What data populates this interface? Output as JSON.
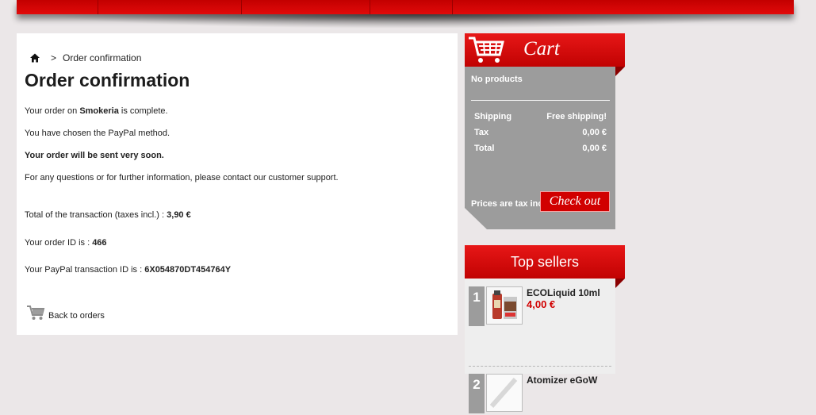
{
  "breadcrumb": {
    "separator": ">",
    "current": "Order confirmation"
  },
  "page": {
    "title": "Order confirmation",
    "line1_before": "Your order on ",
    "shop_name": "Smokeria",
    "line1_after": " is complete.",
    "line2": "You have chosen the PayPal method.",
    "line3": "Your order will be sent very soon.",
    "line4": "For any questions or for further information, please contact our customer support.",
    "total_label": "Total of the transaction (taxes incl.) : ",
    "total_value": "3,90 €",
    "order_id_label": "Your order ID is : ",
    "order_id_value": "466",
    "paypal_id_label": "Your PayPal transaction ID is : ",
    "paypal_id_value": "6X054870DT454764Y",
    "back_label": "Back to orders"
  },
  "cart": {
    "title": "Cart",
    "no_products": "No products",
    "shipping_label": "Shipping",
    "shipping_value": "Free shipping!",
    "tax_label": "Tax",
    "tax_value": "0,00 €",
    "total_label": "Total",
    "total_value": "0,00 €",
    "tax_note": "Prices are tax included",
    "checkout_label": "Check out"
  },
  "top_sellers": {
    "title": "Top sellers",
    "items": [
      {
        "rank": "1",
        "name": "ECOLiquid 10ml",
        "price": "4,00 €"
      },
      {
        "rank": "2",
        "name": "Atomizer eGoW",
        "price": ""
      }
    ]
  },
  "icons": {
    "home": "home-icon",
    "cart": "shopping-cart-icon",
    "back": "cart-small-icon"
  },
  "colors": {
    "brand_red": "#d10000",
    "panel_gray": "#9c9c9c",
    "background": "#ebe7e8"
  }
}
